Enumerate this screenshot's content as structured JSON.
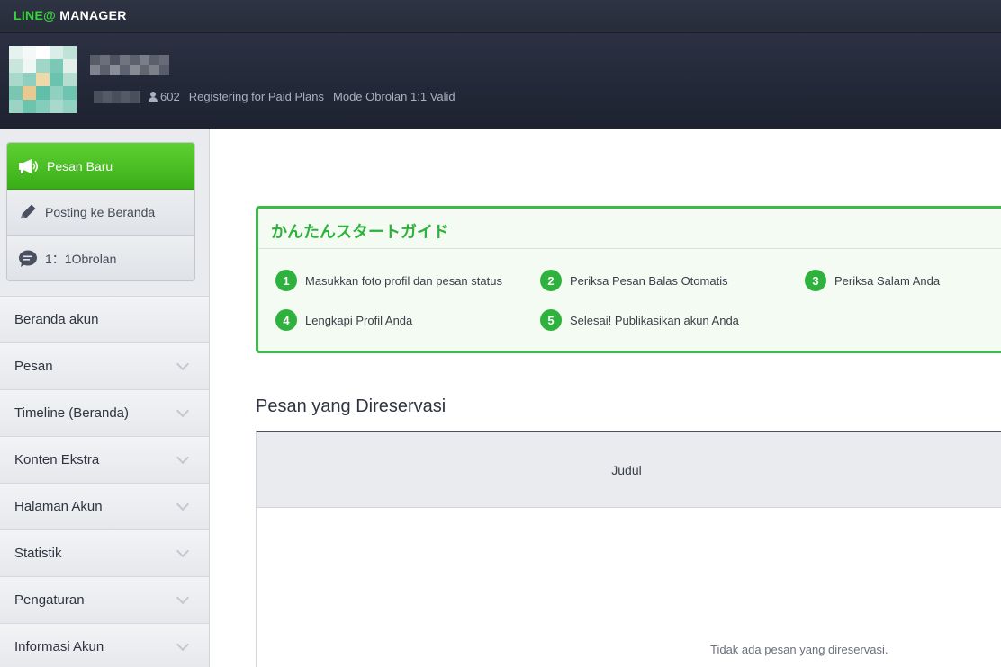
{
  "app": {
    "brand_line": "LINE@",
    "brand_manager": " MANAGER"
  },
  "account": {
    "friends_count": "602",
    "plan_status": "Registering for Paid Plans",
    "chat_mode": "Mode Obrolan 1:1 Valid"
  },
  "quick_actions": [
    {
      "label": "Pesan Baru",
      "icon": "megaphone-icon"
    },
    {
      "label": "Posting ke Beranda",
      "icon": "pencil-icon"
    },
    {
      "label": "1：1Obrolan",
      "icon": "chat-bubble-icon"
    }
  ],
  "nav": [
    {
      "label": "Beranda akun",
      "expandable": false
    },
    {
      "label": "Pesan",
      "expandable": true
    },
    {
      "label": "Timeline (Beranda)",
      "expandable": true
    },
    {
      "label": "Konten Ekstra",
      "expandable": true
    },
    {
      "label": "Halaman Akun",
      "expandable": true
    },
    {
      "label": "Statistik",
      "expandable": true
    },
    {
      "label": "Pengaturan",
      "expandable": true
    },
    {
      "label": "Informasi Akun",
      "expandable": true
    }
  ],
  "guide": {
    "title": "かんたんスタートガイド",
    "steps": [
      {
        "num": "1",
        "label": "Masukkan foto profil dan pesan status"
      },
      {
        "num": "2",
        "label": "Periksa Pesan Balas Otomatis"
      },
      {
        "num": "3",
        "label": "Periksa Salam Anda"
      },
      {
        "num": "4",
        "label": "Lengkapi Profil Anda"
      },
      {
        "num": "5",
        "label": "Selesai! Publikasikan akun Anda"
      }
    ]
  },
  "reserved": {
    "title": "Pesan yang Direservasi",
    "column": "Judul",
    "empty": "Tidak ada pesan yang direservasi."
  },
  "colors": {
    "accent_green": "#2fb13d",
    "header_dark": "#272c39",
    "button_green": "#3aae17"
  }
}
